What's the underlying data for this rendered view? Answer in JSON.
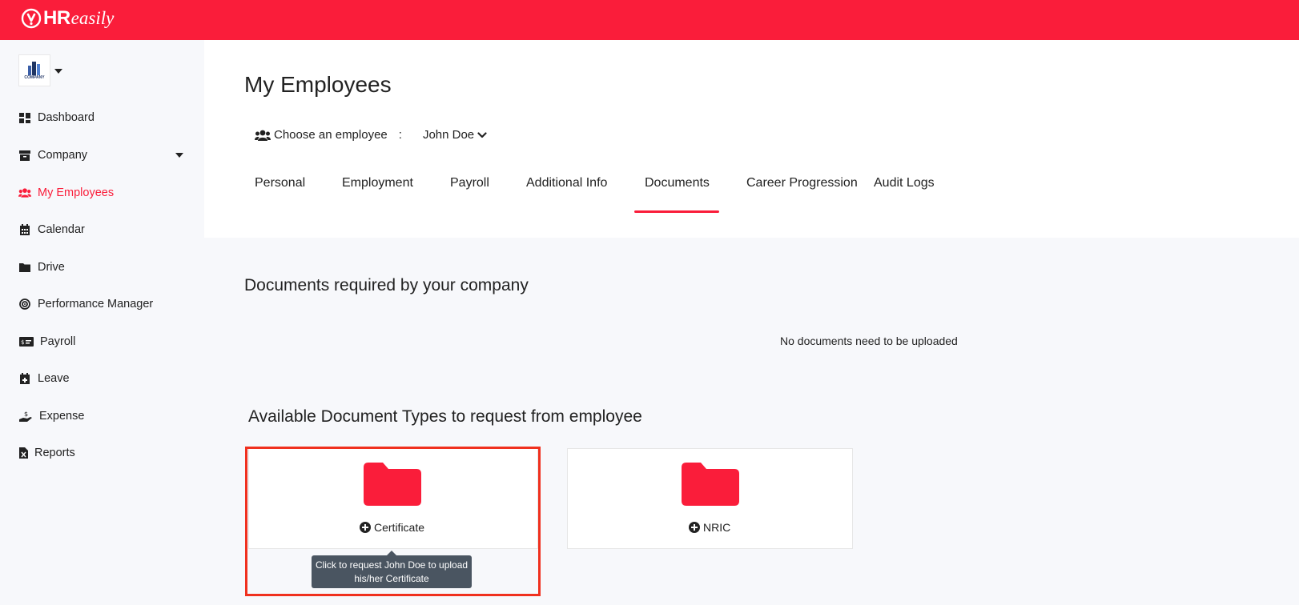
{
  "brand": {
    "hr": "HR",
    "easily": "easily"
  },
  "company": {
    "logo_text": "COMPANY"
  },
  "sidebar": {
    "items": [
      {
        "label": "Dashboard",
        "icon": "dashboard-icon"
      },
      {
        "label": "Company",
        "icon": "archive-icon"
      },
      {
        "label": "My Employees",
        "icon": "users-icon"
      },
      {
        "label": "Calendar",
        "icon": "calendar-icon"
      },
      {
        "label": "Drive",
        "icon": "folder-icon"
      },
      {
        "label": "Performance Manager",
        "icon": "target-icon"
      },
      {
        "label": "Payroll",
        "icon": "money-check-icon"
      },
      {
        "label": "Leave",
        "icon": "calendar-plus-icon"
      },
      {
        "label": "Expense",
        "icon": "hand-dollar-icon"
      },
      {
        "label": "Reports",
        "icon": "file-excel-icon"
      }
    ]
  },
  "header": {
    "title": "My Employees",
    "chooser_label": "Choose an employee",
    "chooser_colon": ":",
    "selected_employee": "John Doe"
  },
  "tabs": [
    "Personal",
    "Employment",
    "Payroll",
    "Additional Info",
    "Documents",
    "Career Progression",
    "Audit Logs"
  ],
  "active_tab": "Documents",
  "documents": {
    "required_title": "Documents required by your company",
    "empty_message": "No documents need to be uploaded",
    "available_title": "Available Document Types to request from employee",
    "types": [
      {
        "label": "Certificate"
      },
      {
        "label": "NRIC"
      }
    ],
    "tooltip": "Click to request John Doe to upload his/her Certificate"
  },
  "colors": {
    "brand": "#fa1d3a",
    "highlight": "#f0301e",
    "tooltip": "#4a5561"
  }
}
